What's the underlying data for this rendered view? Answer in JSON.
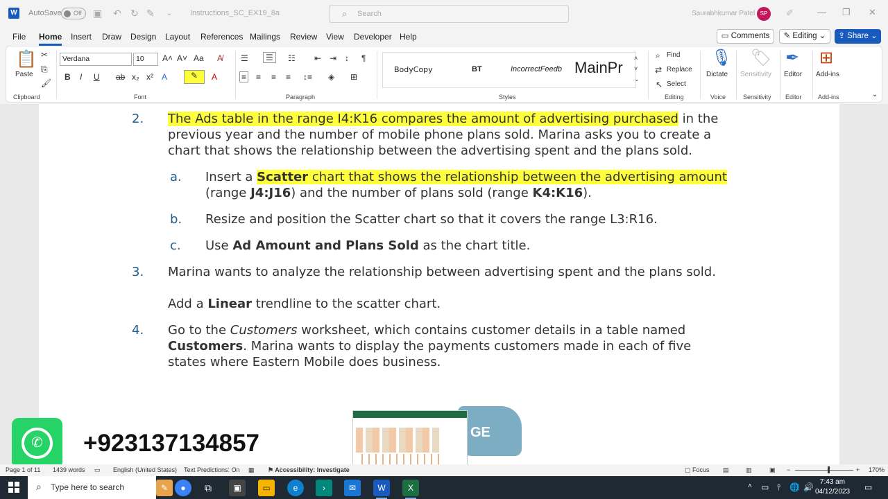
{
  "titlebar": {
    "autosave_label": "AutoSave",
    "autosave_state": "Off",
    "filename": "Instructions_SC_EX19_8a",
    "search_placeholder": "Search",
    "user_name": "Saurabhkumar Patel",
    "user_initials": "SP"
  },
  "menu": {
    "tabs": [
      "File",
      "Home",
      "Insert",
      "Draw",
      "Design",
      "Layout",
      "References",
      "Mailings",
      "Review",
      "View",
      "Developer",
      "Help"
    ],
    "comments_label": "Comments",
    "editing_label": "Editing",
    "share_label": "Share"
  },
  "ribbon": {
    "clipboard": {
      "paste_label": "Paste",
      "group_label": "Clipboard"
    },
    "font": {
      "family": "Verdana",
      "size": "10",
      "group_label": "Font"
    },
    "paragraph": {
      "group_label": "Paragraph"
    },
    "styles": {
      "items": [
        "BodyCopy",
        "BT",
        "IncorrectFeedb",
        "MainPr"
      ],
      "group_label": "Styles"
    },
    "editing": {
      "find_label": "Find",
      "replace_label": "Replace",
      "select_label": "Select",
      "group_label": "Editing"
    },
    "voice": {
      "dictate_label": "Dictate",
      "group_label": "Voice"
    },
    "sensitivity": {
      "button_label": "Sensitivity",
      "group_label": "Sensitivity"
    },
    "editor": {
      "button_label": "Editor",
      "group_label": "Editor"
    },
    "addins": {
      "button_label": "Add-ins",
      "group_label": "Add-ins"
    }
  },
  "document": {
    "item2": {
      "number": "2.",
      "highlighted": "The Ads table in the range I4:K16 compares the amount of advertising purchased",
      "line1_rest": " in the",
      "line2": "previous year and the number of mobile phone plans sold. Marina asks you to create a",
      "line3": "chart that shows the relationship between the advertising spent and the plans sold."
    },
    "item2a": {
      "letter": "a.",
      "prefix": "Insert a ",
      "bold_hl": "Scatter",
      "hl_rest": " chart that shows the relationship between the advertising amount",
      "line2_pre": "(range ",
      "line2_b1": "J4:J16",
      "line2_mid": ") and the number of plans sold (range ",
      "line2_b2": "K4:K16",
      "line2_end": ")."
    },
    "item2b": {
      "letter": "b.",
      "text": "Resize and position the Scatter chart so that it covers the range L3:R16."
    },
    "item2c": {
      "letter": "c.",
      "prefix": "Use ",
      "bold": "Ad Amount and Plans Sold",
      "suffix": " as the chart title."
    },
    "item3": {
      "number": "3.",
      "line1": "Marina wants to analyze the relationship between advertising spent and the plans sold.",
      "line2_pre": "Add a ",
      "line2_bold": "Linear",
      "line2_post": " trendline to the scatter chart."
    },
    "item4": {
      "number": "4.",
      "line1_pre": "Go to the ",
      "line1_ital": "Customers",
      "line1_post": " worksheet, which contains customer details in a table named",
      "line2_bold": "Customers",
      "line2_post": ". Marina wants to display the payments customers made in each of five",
      "line3": "states where Eastern Mobile does business."
    }
  },
  "overlay": {
    "phone": "+923137134857",
    "brush_text": "GE"
  },
  "statusbar": {
    "page": "Page 1 of 11",
    "words": "1439 words",
    "language": "English (United States)",
    "predictions": "Text Predictions: On",
    "accessibility": "Accessibility: Investigate",
    "focus": "Focus",
    "zoom": "170%"
  },
  "taskbar": {
    "search_placeholder": "Type here to search",
    "time": "7:43 am",
    "date": "04/12/2023"
  }
}
